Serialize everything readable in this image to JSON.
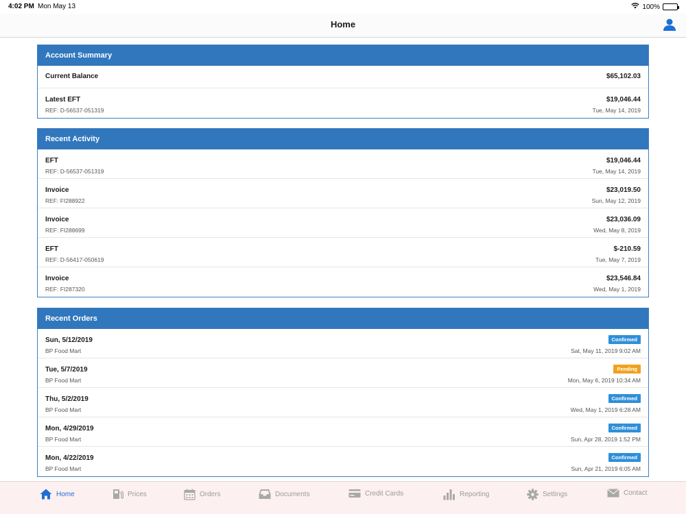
{
  "status_bar": {
    "time": "4:02 PM",
    "date": "Mon May 13",
    "battery": "100%"
  },
  "nav": {
    "title": "Home"
  },
  "account_summary": {
    "header": "Account Summary",
    "current_balance_label": "Current Balance",
    "current_balance_value": "$65,102.03",
    "latest_eft_label": "Latest EFT",
    "latest_eft_value": "$19,046.44",
    "latest_eft_ref": "REF: D-56537-051319",
    "latest_eft_date": "Tue, May 14, 2019"
  },
  "recent_activity": {
    "header": "Recent Activity",
    "items": [
      {
        "type": "EFT",
        "ref": "REF: D-56537-051319",
        "amount": "$19,046.44",
        "date": "Tue, May 14, 2019"
      },
      {
        "type": "Invoice",
        "ref": "REF: FI288922",
        "amount": "$23,019.50",
        "date": "Sun, May 12, 2019"
      },
      {
        "type": "Invoice",
        "ref": "REF: FI288699",
        "amount": "$23,036.09",
        "date": "Wed, May 8, 2019"
      },
      {
        "type": "EFT",
        "ref": "REF: D-56417-050619",
        "amount": "$-210.59",
        "date": "Tue, May 7, 2019"
      },
      {
        "type": "Invoice",
        "ref": "REF: FI287320",
        "amount": "$23,546.84",
        "date": "Wed, May 1, 2019"
      }
    ]
  },
  "recent_orders": {
    "header": "Recent Orders",
    "items": [
      {
        "date": "Sun, 5/12/2019",
        "store": "BP Food Mart",
        "status": "Confirmed",
        "timestamp": "Sat, May 11, 2019 9:02 AM"
      },
      {
        "date": "Tue, 5/7/2019",
        "store": "BP Food Mart",
        "status": "Pending",
        "timestamp": "Mon, May 6, 2019 10:34 AM"
      },
      {
        "date": "Thu, 5/2/2019",
        "store": "BP Food Mart",
        "status": "Confirmed",
        "timestamp": "Wed, May 1, 2019 6:28 AM"
      },
      {
        "date": "Mon, 4/29/2019",
        "store": "BP Food Mart",
        "status": "Confirmed",
        "timestamp": "Sun, Apr 28, 2019 1:52 PM"
      },
      {
        "date": "Mon, 4/22/2019",
        "store": "BP Food Mart",
        "status": "Confirmed",
        "timestamp": "Sun, Apr 21, 2019 6:05 AM"
      }
    ]
  },
  "colors": {
    "accent": "#3077be",
    "tab_active": "#1d6fd6",
    "confirmed": "#2f8fd8",
    "pending": "#f0a21e"
  },
  "tabs": [
    {
      "label": "Home",
      "icon": "home-icon",
      "active": true
    },
    {
      "label": "Prices",
      "icon": "fuel-pump-icon",
      "active": false
    },
    {
      "label": "Orders",
      "icon": "calendar-icon",
      "active": false
    },
    {
      "label": "Documents",
      "icon": "inbox-icon",
      "active": false
    },
    {
      "label": "Credit Cards",
      "icon": "credit-card-icon",
      "active": false
    },
    {
      "label": "Reporting",
      "icon": "bar-chart-icon",
      "active": false
    },
    {
      "label": "Settings",
      "icon": "gear-icon",
      "active": false
    },
    {
      "label": "Contact",
      "icon": "envelope-icon",
      "active": false
    }
  ]
}
